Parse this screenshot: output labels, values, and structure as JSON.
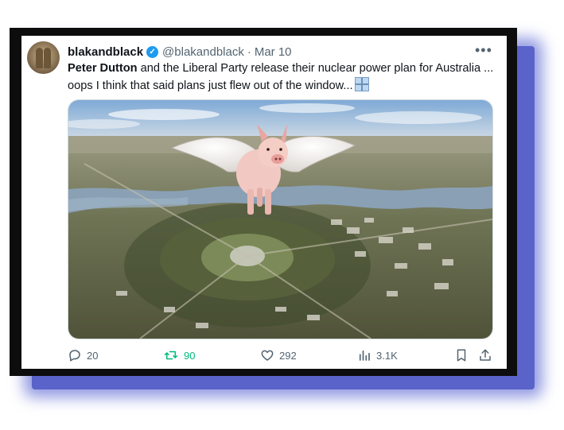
{
  "tweet": {
    "display_name": "blakandblack",
    "handle": "@blakandblack",
    "separator": "·",
    "date": "Mar 10",
    "text_bold": "Peter Dutton",
    "text_rest": " and the Liberal Party release their nuclear power plan for Australia ... oops I think that said plans just flew out of the window...",
    "emoji": "window-emoji",
    "verified_badge": "✓"
  },
  "actions": {
    "replies": "20",
    "reposts": "90",
    "likes": "292",
    "views": "3.1K"
  },
  "icons": [
    "verified-icon",
    "more-icon",
    "reply-icon",
    "repost-icon",
    "like-icon",
    "views-icon",
    "bookmark-icon",
    "share-icon"
  ],
  "colors": {
    "accent_blue": "#1d9bf0",
    "repost_green": "#00ba7c",
    "muted_text": "#536471",
    "frame": "#0d0d0d",
    "shadow": "#5a63c9"
  }
}
